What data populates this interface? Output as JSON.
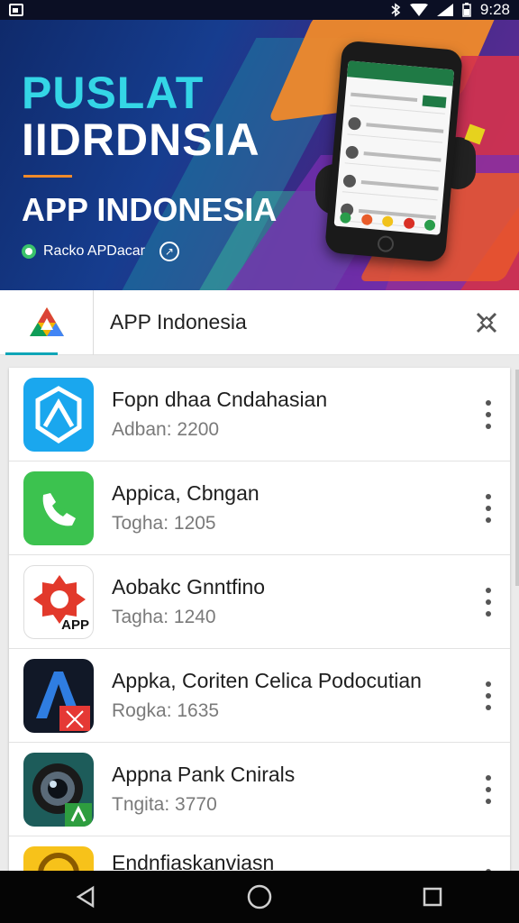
{
  "status_bar": {
    "time": "9:28",
    "icons": [
      "notification-icon",
      "bluetooth-icon",
      "wifi-icon",
      "signal-icon",
      "battery-icon"
    ]
  },
  "banner": {
    "line1": "PUSLAT",
    "line2": "IIDRDNSIA",
    "line3": "APP INDONESIA",
    "subtitle": "Racko APDacar",
    "colors": {
      "accent": "#34d6e6",
      "orange": "#f08a2a"
    }
  },
  "header": {
    "app_name": "APP Indonesia",
    "logo_icon": "triangle-logo-icon",
    "close_icon": "close-x-icon"
  },
  "apps": [
    {
      "title": "Fopn dhaa Cndahasian",
      "meta": "Adban: 2200",
      "icon": "hexagon-app-icon"
    },
    {
      "title": "Appica, Cbngan",
      "meta": "Togha: 1205",
      "icon": "phone-app-icon"
    },
    {
      "title": "Aobakc Gnntfino",
      "meta": "Tagha: 1240",
      "icon": "gear-app-icon",
      "badge": "APP"
    },
    {
      "title": "Appka, Coriten Celica Podocutian",
      "meta": "Rogka: 1635",
      "icon": "letter-a-app-icon"
    },
    {
      "title": "Appna Pank Cnirals",
      "meta": "Tngita: 3770",
      "icon": "camera-app-icon"
    },
    {
      "title": "Endnfiaskanviasn",
      "meta": "",
      "icon": "yellow-app-icon"
    }
  ],
  "navbar": {
    "back": "back-icon",
    "home": "home-icon",
    "recents": "recents-icon"
  }
}
